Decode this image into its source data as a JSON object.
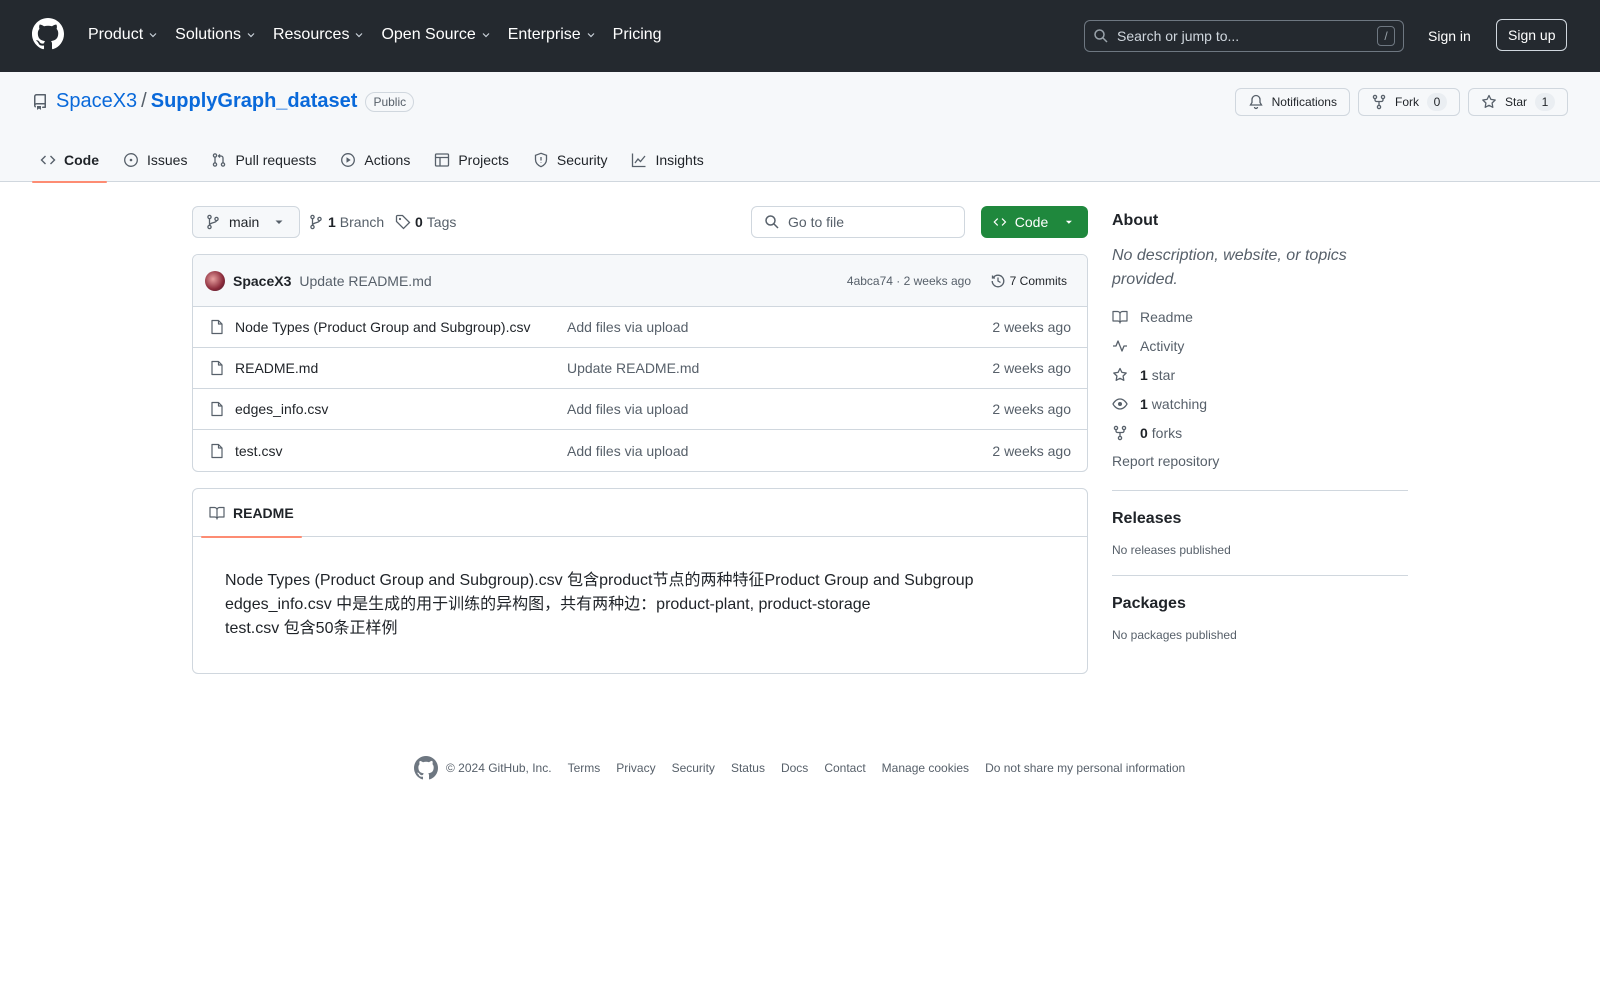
{
  "header": {
    "nav": [
      {
        "label": "Product",
        "has_dropdown": true
      },
      {
        "label": "Solutions",
        "has_dropdown": true
      },
      {
        "label": "Resources",
        "has_dropdown": true
      },
      {
        "label": "Open Source",
        "has_dropdown": true
      },
      {
        "label": "Enterprise",
        "has_dropdown": true
      },
      {
        "label": "Pricing",
        "has_dropdown": false
      }
    ],
    "search_placeholder": "Search or jump to...",
    "search_shortcut": "/",
    "sign_in": "Sign in",
    "sign_up": "Sign up"
  },
  "repo": {
    "owner": "SpaceX3",
    "separator": "/",
    "name": "SupplyGraph_dataset",
    "visibility": "Public",
    "actions": {
      "notifications": "Notifications",
      "fork": "Fork",
      "fork_count": "0",
      "star": "Star",
      "star_count": "1"
    },
    "tabs": [
      {
        "label": "Code",
        "icon": "code-icon",
        "selected": true
      },
      {
        "label": "Issues",
        "icon": "issue-icon",
        "selected": false
      },
      {
        "label": "Pull requests",
        "icon": "pull-request-icon",
        "selected": false
      },
      {
        "label": "Actions",
        "icon": "play-icon",
        "selected": false
      },
      {
        "label": "Projects",
        "icon": "table-icon",
        "selected": false
      },
      {
        "label": "Security",
        "icon": "shield-icon",
        "selected": false
      },
      {
        "label": "Insights",
        "icon": "graph-icon",
        "selected": false
      }
    ]
  },
  "toolbar": {
    "branch": "main",
    "branch_count": "1",
    "branch_label": "Branch",
    "tag_count": "0",
    "tag_label": "Tags",
    "goto_placeholder": "Go to file",
    "code_button": "Code"
  },
  "commit": {
    "author": "SpaceX3",
    "message": "Update README.md",
    "hash_time": "4abca74 · 2 weeks ago",
    "commits_label": "7 Commits"
  },
  "files": [
    {
      "name": "Node Types (Product Group and Subgroup).csv",
      "message": "Add files via upload",
      "date": "2 weeks ago"
    },
    {
      "name": "README.md",
      "message": "Update README.md",
      "date": "2 weeks ago"
    },
    {
      "name": "edges_info.csv",
      "message": "Add files via upload",
      "date": "2 weeks ago"
    },
    {
      "name": "test.csv",
      "message": "Add files via upload",
      "date": "2 weeks ago"
    }
  ],
  "readme": {
    "tab_label": "README",
    "lines": [
      "Node Types (Product Group and Subgroup).csv 包含product节点的两种特征Product Group and Subgroup",
      "edges_info.csv 中是生成的用于训练的异构图，共有两种边：product-plant, product-storage",
      "test.csv 包含50条正样例"
    ]
  },
  "sidebar": {
    "about_title": "About",
    "about_desc": "No description, website, or topics provided.",
    "links": {
      "readme": "Readme",
      "activity": "Activity",
      "stars_count": "1",
      "stars_label": "star",
      "watching_count": "1",
      "watching_label": "watching",
      "forks_count": "0",
      "forks_label": "forks"
    },
    "report": "Report repository",
    "releases_title": "Releases",
    "releases_empty": "No releases published",
    "packages_title": "Packages",
    "packages_empty": "No packages published"
  },
  "footer": {
    "copyright": "© 2024 GitHub, Inc.",
    "links": [
      "Terms",
      "Privacy",
      "Security",
      "Status",
      "Docs",
      "Contact",
      "Manage cookies",
      "Do not share my personal information"
    ]
  },
  "colors": {
    "header_bg": "#24292f",
    "link_blue": "#0969da",
    "code_green": "#1f883d",
    "tab_underline": "#fd8c73"
  }
}
